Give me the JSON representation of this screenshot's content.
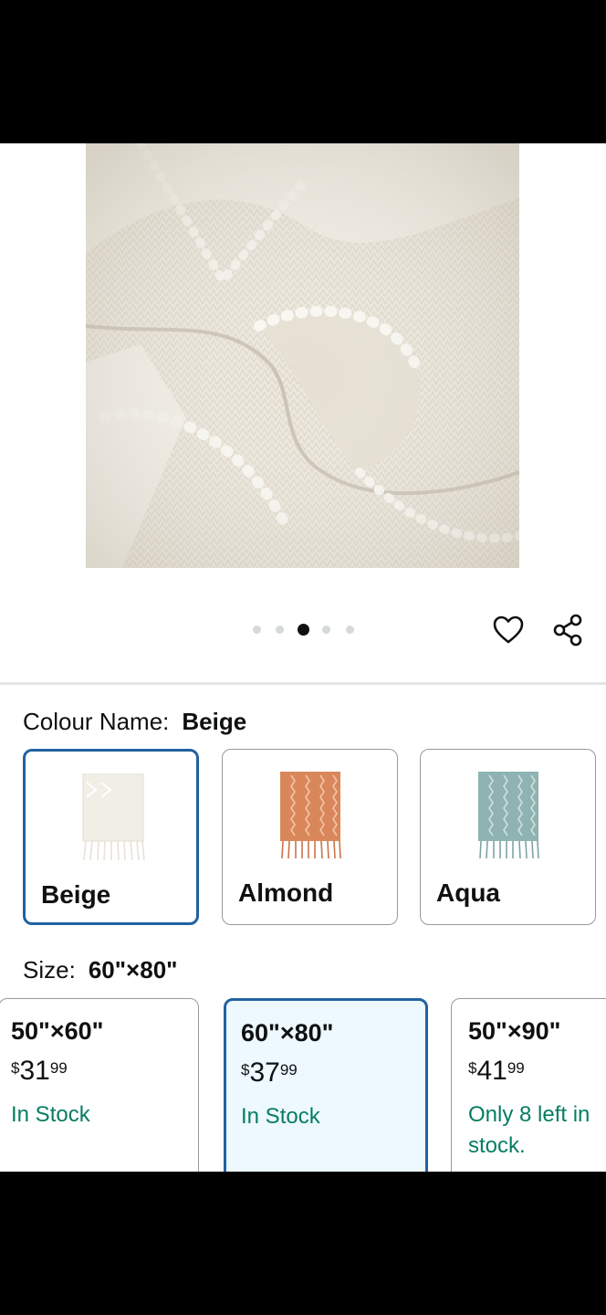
{
  "product": {
    "image_alt": "",
    "carousel": {
      "count": 5,
      "active_index": 2
    }
  },
  "actions": {
    "wishlist_icon": "heart-outline-icon",
    "share_icon": "share-icon"
  },
  "colour": {
    "label": "Colour Name:",
    "selected": "Beige",
    "options": [
      {
        "name": "Beige",
        "color": "#f1eee6",
        "stripe": "#ffffff"
      },
      {
        "name": "Almond",
        "color": "#d9875a",
        "stripe": "#f3c4a8"
      },
      {
        "name": "Aqua",
        "color": "#8fb3b3",
        "stripe": "#cfe0df"
      }
    ]
  },
  "size": {
    "label": "Size:",
    "selected": "60\"×80\"",
    "options": [
      {
        "size": "50\"×60\"",
        "currency": "$",
        "whole": "31",
        "cents": "99",
        "stock": "In Stock"
      },
      {
        "size": "60\"×80\"",
        "currency": "$",
        "whole": "37",
        "cents": "99",
        "stock": "In Stock"
      },
      {
        "size": "50\"×90\"",
        "currency": "$",
        "whole": "41",
        "cents": "99",
        "stock": "Only 8 left in stock."
      }
    ]
  },
  "colors": {
    "selected_border": "#2162a1",
    "stock_green": "#067d62",
    "selected_bg": "#edf8ff"
  }
}
